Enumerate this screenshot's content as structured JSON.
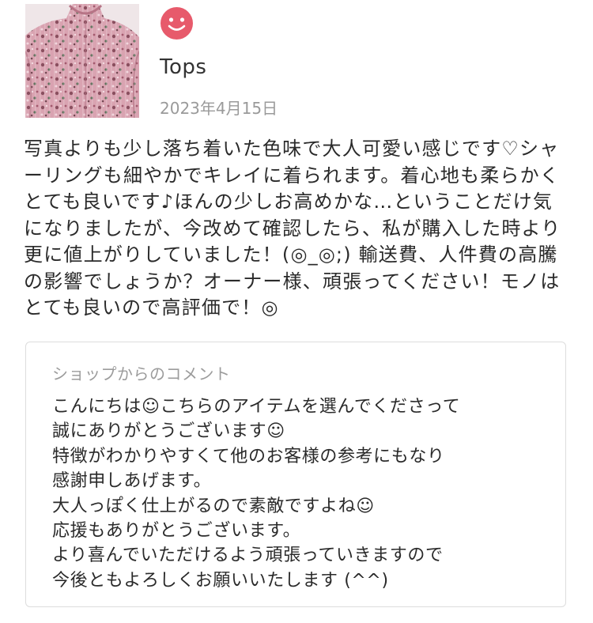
{
  "product": {
    "name": "Tops",
    "image_icon": "product-photo-floral-blouse"
  },
  "rating": {
    "icon": "smiley-face-icon",
    "color": "#e75a6b"
  },
  "review": {
    "date": "2023年4月15日",
    "text": "写真よりも少し落ち着いた色味で大人可愛い感じです♡シャーリングも細やかでキレイに着られます。着心地も柔らかくとても良いです♪ほんの少しお高めかな…ということだけ気になりましたが、今改めて確認したら、私が購入した時より更に値上がりしていました！(◎_◎;) 輸送費、人件費の高騰の影響でしょうか？オーナー様、頑張ってください！モノはとても良いので高評価で！◎"
  },
  "shop_reply": {
    "heading": "ショップからのコメント",
    "lines": [
      "こんにちは☺こちらのアイテムを選んでくださって",
      "誠にありがとうございます☺",
      "特徴がわかりやすくて他のお客様の参考にもなり",
      "感謝申しあげます。",
      "大人っぽく仕上がるので素敵ですよね☺",
      "応援もありがとうございます。",
      "より喜んでいただけるよう頑張っていきますので",
      "今後ともよろしくお願いいたします (^^)"
    ]
  },
  "colors": {
    "accent": "#e75a6b",
    "border": "#dddddd",
    "muted_text": "#9a9a9a"
  }
}
